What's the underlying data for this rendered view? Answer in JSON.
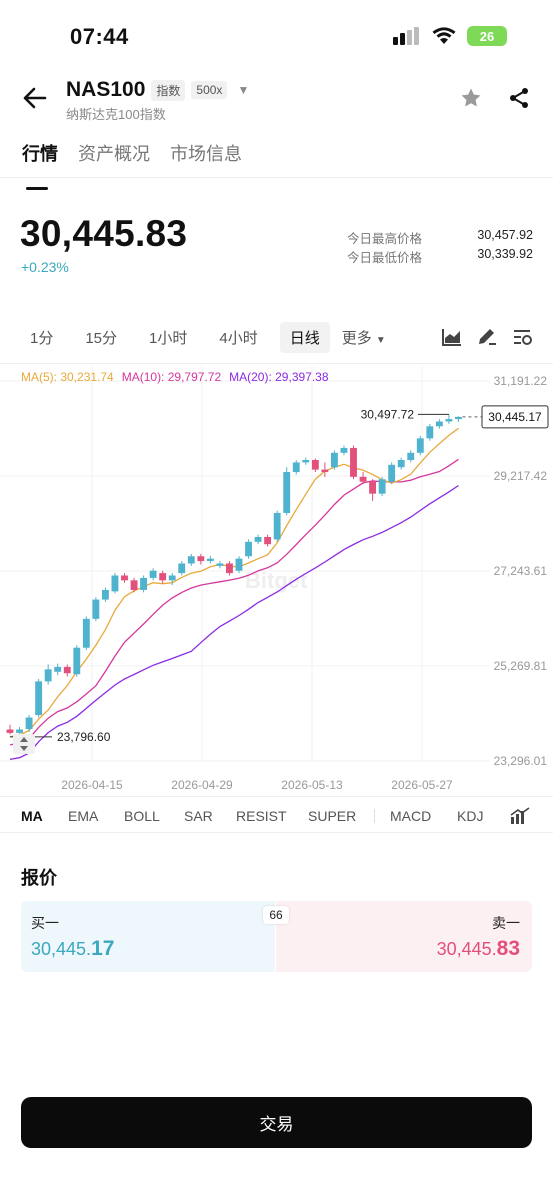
{
  "status": {
    "time": "07:44",
    "battery": "26"
  },
  "header": {
    "symbol": "NAS100",
    "tag_type": "指数",
    "tag_leverage": "500x",
    "subtitle": "纳斯达克100指数"
  },
  "tabs": [
    {
      "label": "行情",
      "active": true
    },
    {
      "label": "资产概况",
      "active": false
    },
    {
      "label": "市场信息",
      "active": false
    }
  ],
  "price": {
    "last": "30,445.83",
    "change": "+0.23%",
    "high_label": "今日最高价格",
    "high": "30,457.92",
    "low_label": "今日最低价格",
    "low": "30,339.92"
  },
  "intervals": [
    "1分",
    "15分",
    "1小时",
    "4小时",
    "日线"
  ],
  "interval_active": "日线",
  "interval_more": "更多",
  "ma_legend": {
    "ma5": "MA(5): 30,231.74",
    "ma10": "MA(10): 29,797.72",
    "ma20": "MA(20): 29,397.38"
  },
  "colors": {
    "up": "#4fb3cf",
    "down": "#e2507c",
    "ma5": "#e8a93a",
    "ma10": "#d6379d",
    "ma20": "#8a2be2"
  },
  "chart_data": {
    "type": "candlestick",
    "y_ticks": [
      "31,191.22",
      "29,217.42",
      "27,243.61",
      "25,269.81",
      "23,296.01"
    ],
    "ylim": [
      23296.01,
      31191.22
    ],
    "x_ticks": [
      "2026-04-15",
      "2026-04-29",
      "2026-05-13",
      "2026-05-27"
    ],
    "high_marker": "30,497.72",
    "low_marker": "23,796.60",
    "current_label": "30,445.17",
    "candles": [
      [
        23950,
        23880,
        24050,
        23850
      ],
      [
        23880,
        23950,
        24000,
        23820
      ],
      [
        23960,
        24200,
        24250,
        23900
      ],
      [
        24250,
        24950,
        25000,
        24200
      ],
      [
        24950,
        25200,
        25300,
        24880
      ],
      [
        25150,
        25250,
        25320,
        25080
      ],
      [
        25250,
        25120,
        25300,
        25050
      ],
      [
        25100,
        25650,
        25700,
        25050
      ],
      [
        25650,
        26250,
        26300,
        25600
      ],
      [
        26250,
        26650,
        26700,
        26200
      ],
      [
        26650,
        26850,
        26900,
        26600
      ],
      [
        26820,
        27150,
        27200,
        26780
      ],
      [
        27150,
        27050,
        27200,
        27000
      ],
      [
        27050,
        26850,
        27100,
        26800
      ],
      [
        26850,
        27100,
        27150,
        26800
      ],
      [
        27100,
        27250,
        27300,
        27050
      ],
      [
        27200,
        27050,
        27250,
        26980
      ],
      [
        27050,
        27150,
        27200,
        26950
      ],
      [
        27200,
        27400,
        27450,
        27150
      ],
      [
        27400,
        27550,
        27600,
        27350
      ],
      [
        27550,
        27450,
        27600,
        27380
      ],
      [
        27450,
        27500,
        27560,
        27400
      ],
      [
        27350,
        27400,
        27450,
        27300
      ],
      [
        27400,
        27200,
        27450,
        27150
      ],
      [
        27250,
        27500,
        27550,
        27200
      ],
      [
        27550,
        27850,
        27900,
        27500
      ],
      [
        27850,
        27950,
        28000,
        27800
      ],
      [
        27950,
        27800,
        28000,
        27750
      ],
      [
        27900,
        28450,
        28500,
        27850
      ],
      [
        28450,
        29300,
        29400,
        28400
      ],
      [
        29300,
        29500,
        29550,
        29250
      ],
      [
        29500,
        29550,
        29600,
        29450
      ],
      [
        29550,
        29350,
        29580,
        29300
      ],
      [
        29350,
        29300,
        29500,
        29200
      ],
      [
        29400,
        29700,
        29750,
        29350
      ],
      [
        29700,
        29800,
        29850,
        29650
      ],
      [
        29800,
        29200,
        29850,
        29150
      ],
      [
        29200,
        29100,
        29300,
        29050
      ],
      [
        29100,
        28850,
        29150,
        28700
      ],
      [
        28850,
        29150,
        29200,
        28800
      ],
      [
        29100,
        29450,
        29500,
        29050
      ],
      [
        29400,
        29550,
        29600,
        29350
      ],
      [
        29550,
        29700,
        29750,
        29500
      ],
      [
        29700,
        30000,
        30050,
        29650
      ],
      [
        30000,
        30250,
        30300,
        29950
      ],
      [
        30250,
        30350,
        30400,
        30200
      ],
      [
        30350,
        30400,
        30497.72,
        30300
      ],
      [
        30400,
        30445.17,
        30457.92,
        30339.92
      ]
    ]
  },
  "indicators": [
    "MA",
    "EMA",
    "BOLL",
    "SAR",
    "RESIST",
    "SUPER",
    "MACD",
    "KDJ"
  ],
  "indicator_active": "MA",
  "quote": {
    "title": "报价",
    "bid_label": "买一",
    "bid_prefix": "30,445.",
    "bid_suffix": "17",
    "ask_label": "卖一",
    "ask_prefix": "30,445.",
    "ask_suffix": "83",
    "spread": "66"
  },
  "trade_label": "交易"
}
